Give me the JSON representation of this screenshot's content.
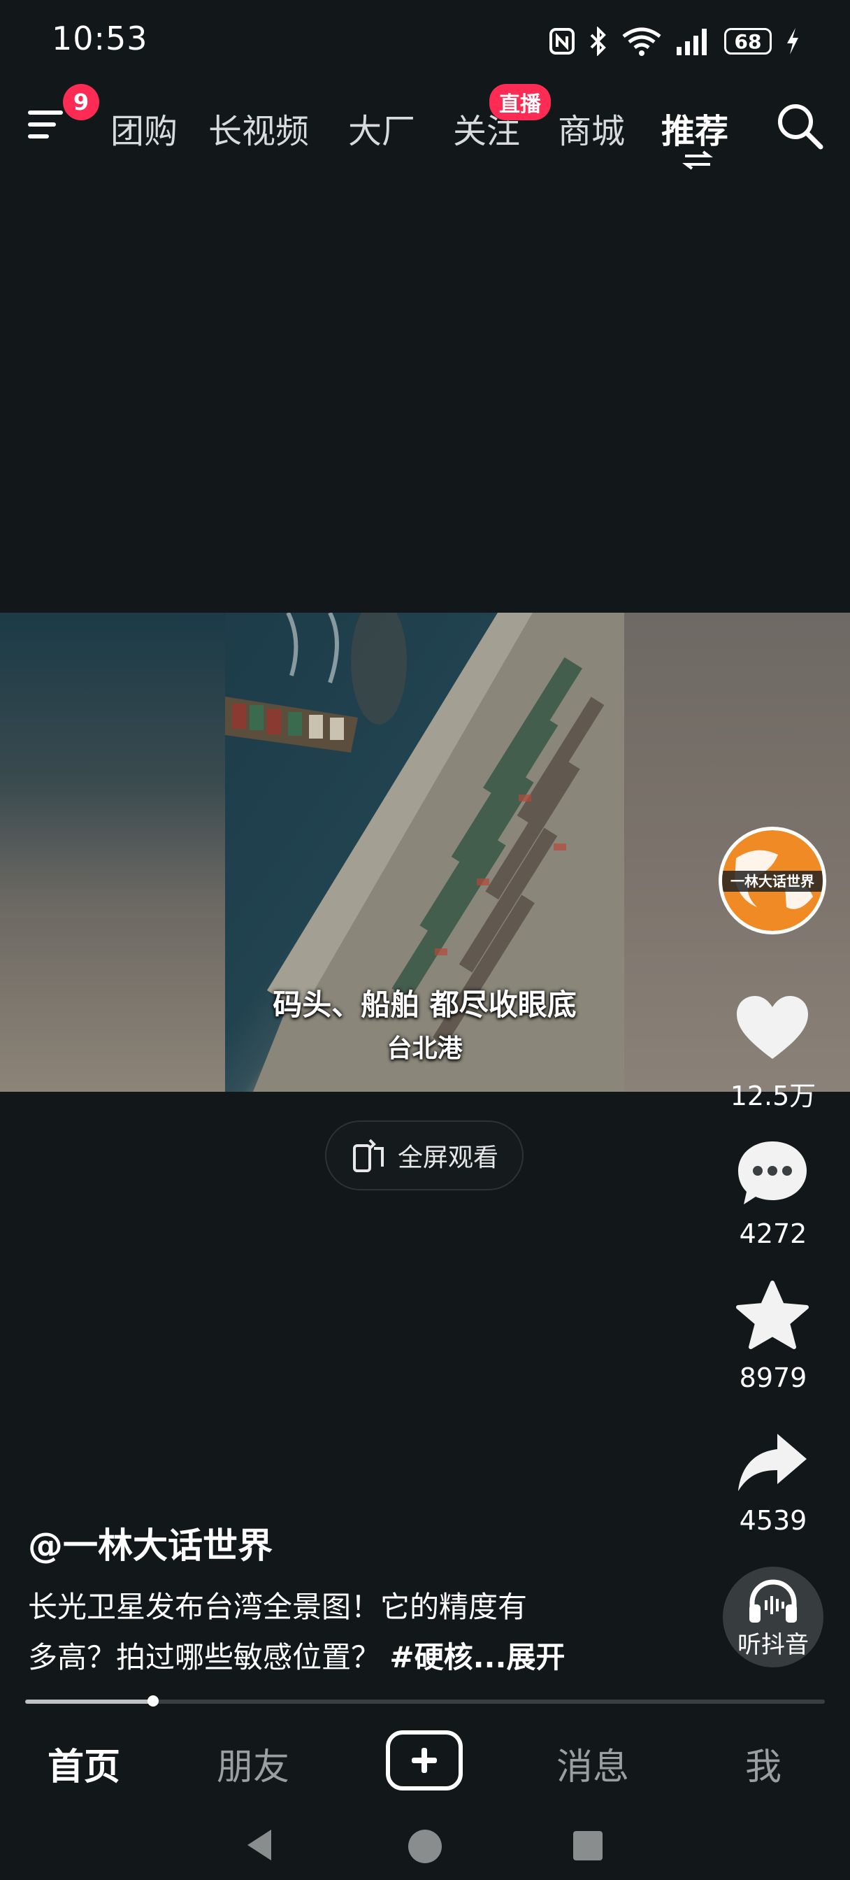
{
  "status_bar": {
    "time": "10:53",
    "battery": "68",
    "icons": [
      "nfc-icon",
      "bluetooth-icon",
      "wifi-icon",
      "signal-icon",
      "battery-icon",
      "charging-icon"
    ]
  },
  "top_nav": {
    "menu_badge": "9",
    "tabs": [
      "团购",
      "长视频",
      "大厂",
      "关注",
      "商城",
      "推荐"
    ],
    "active_tab": "推荐",
    "live_badge": "直播"
  },
  "video": {
    "caption_main": "码头、船舶 都尽收眼底",
    "caption_sub": "台北港",
    "fullscreen_label": "全屏观看"
  },
  "right_rail": {
    "avatar_text": "一林大话世界",
    "likes": "12.5万",
    "comments": "4272",
    "favorites": "8979",
    "shares": "4539",
    "listen_label": "听抖音"
  },
  "post": {
    "author": "@一林大话世界",
    "description_line1": "长光卫星发布台湾全景图！它的精度有",
    "description_line2": "多高？拍过哪些敏感位置？",
    "hashtag": "#硬核",
    "expand": "...展开",
    "progress": 0.16
  },
  "bottom_nav": {
    "items": [
      "首页",
      "朋友",
      "消息",
      "我"
    ],
    "active": "首页"
  },
  "colors": {
    "accent": "#fe2c55",
    "background": "#121719"
  }
}
